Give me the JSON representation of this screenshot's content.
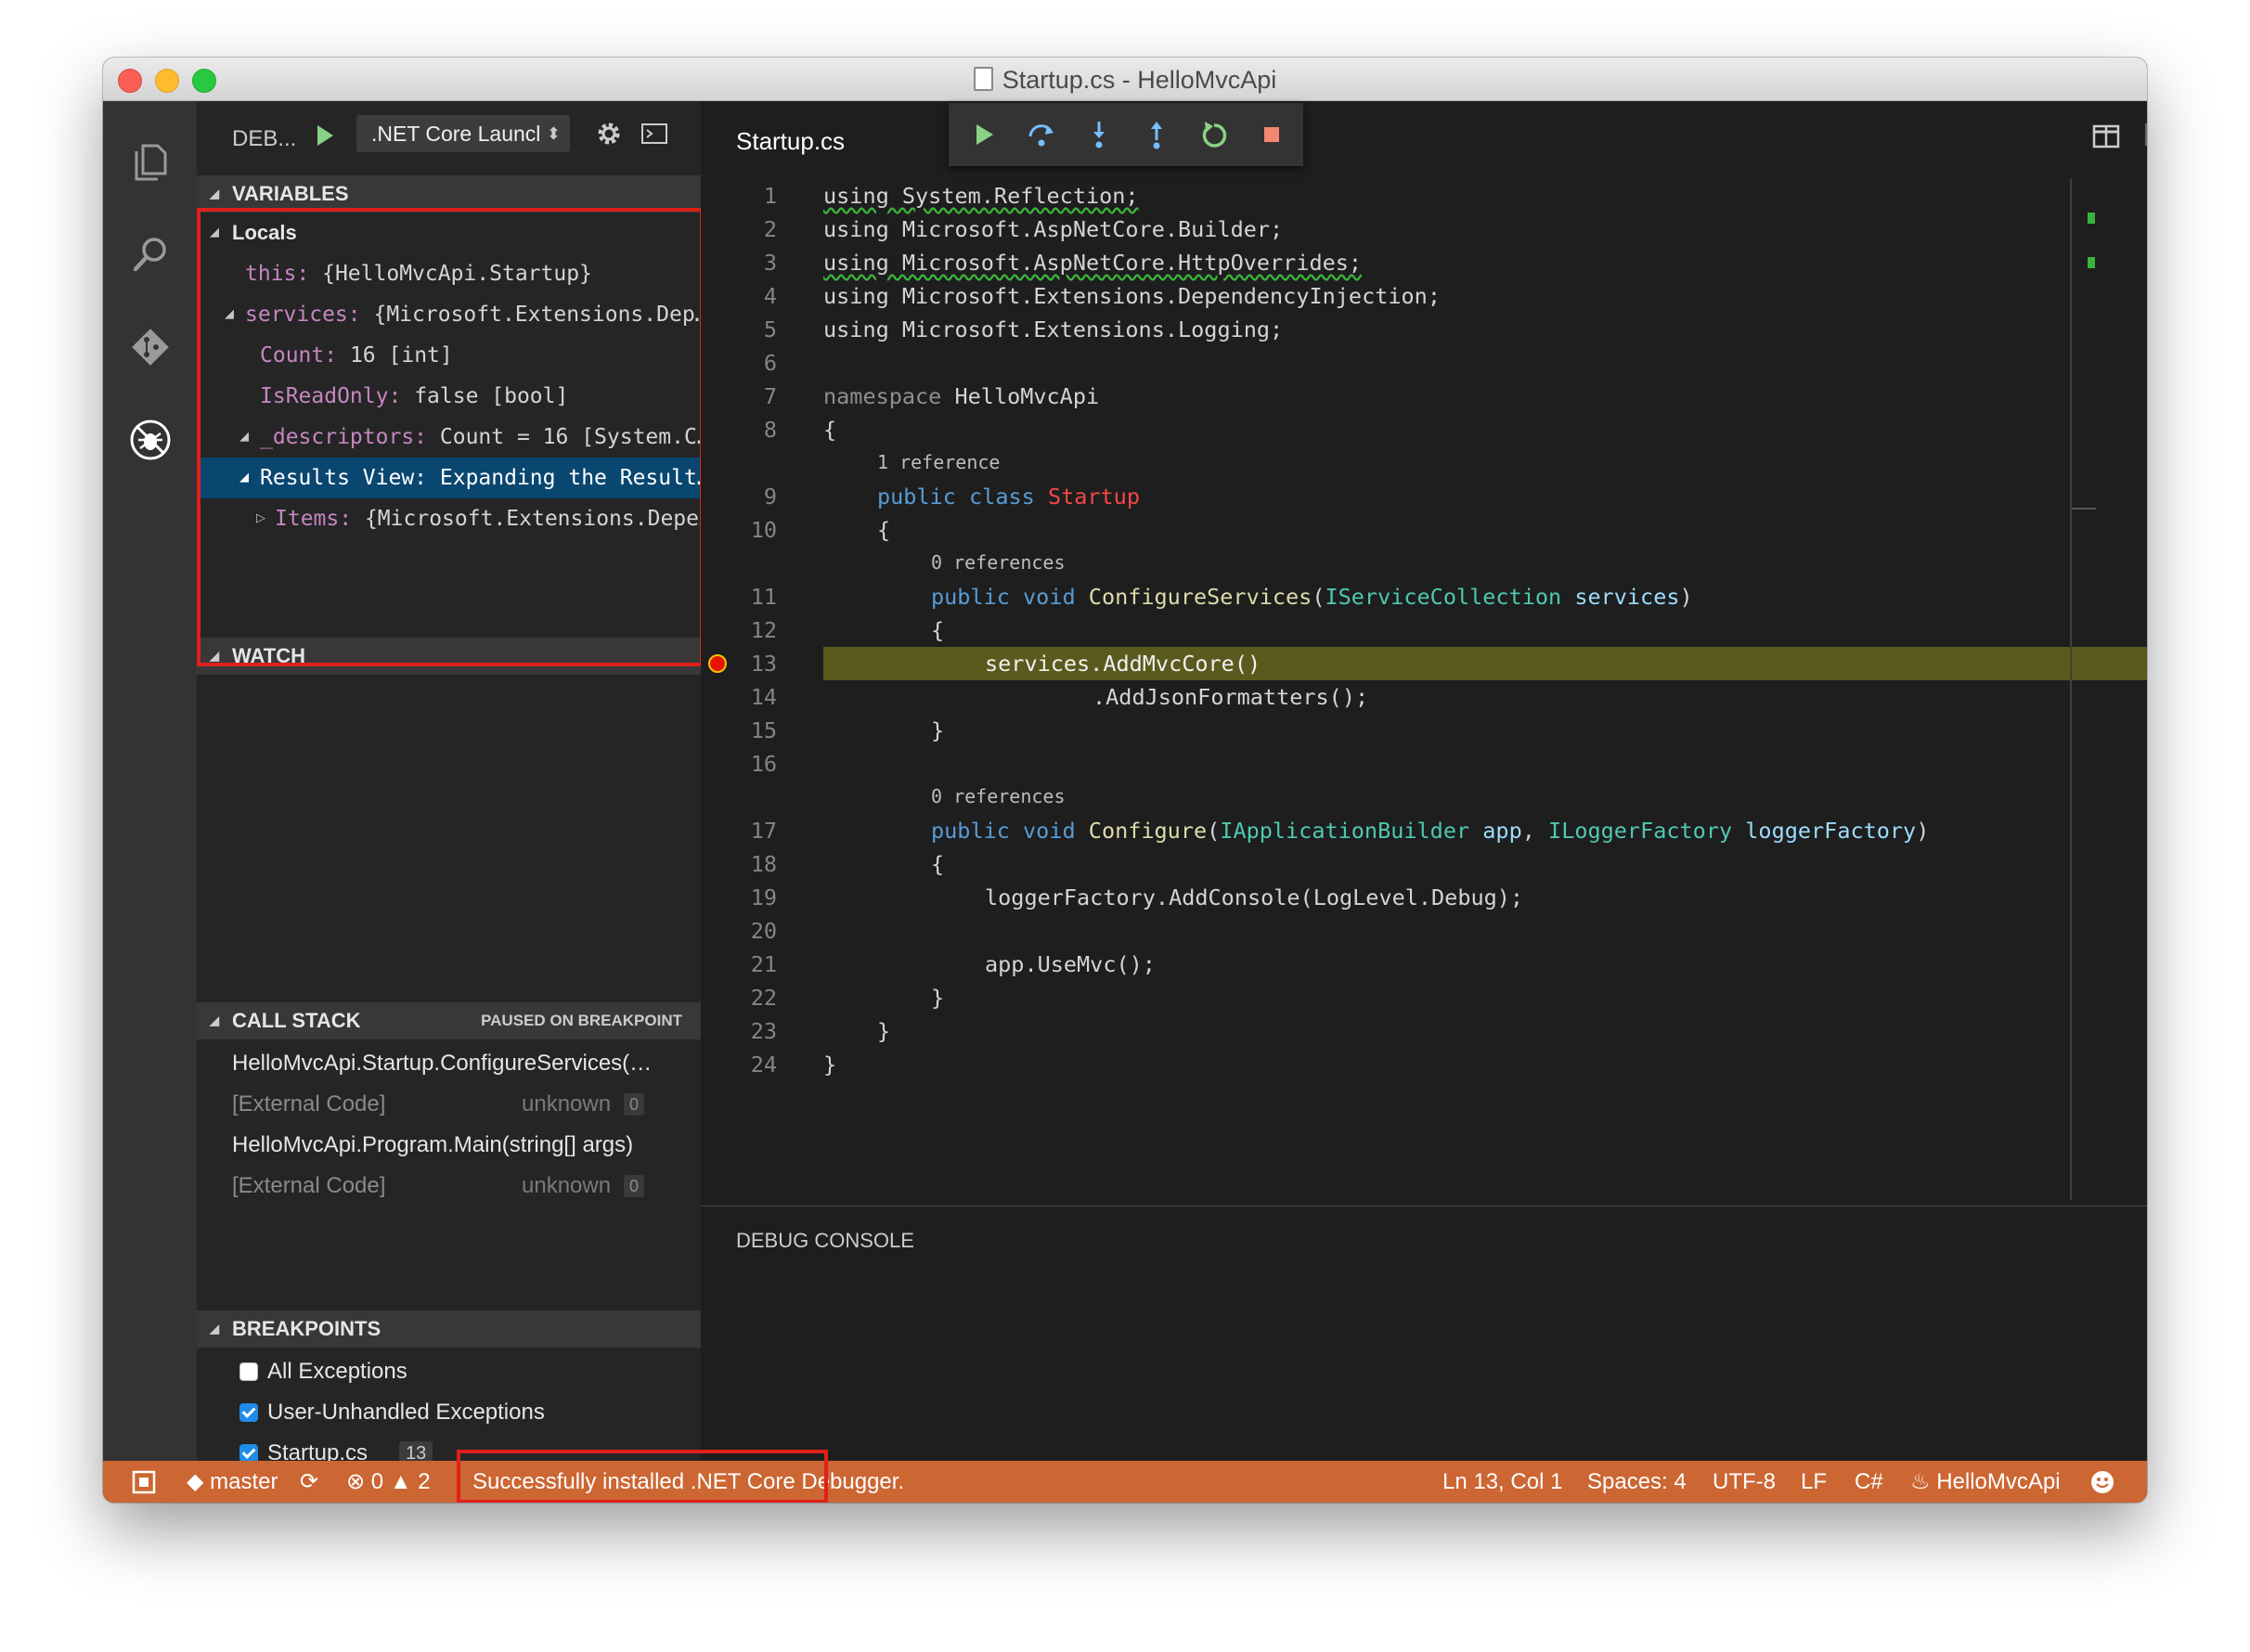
{
  "window": {
    "title": "Startup.cs - HelloMvcApi"
  },
  "debug_header": {
    "label": "DEB...",
    "configuration": ".NET Core Launcl"
  },
  "variables": {
    "title": "VARIABLES",
    "scope": "Locals",
    "items": [
      {
        "key": "this:",
        "value": "{HelloMvcApi.Startup}"
      },
      {
        "key": "services:",
        "value": "{Microsoft.Extensions.Dep…"
      },
      {
        "key": "Count:",
        "value": "16 [int]"
      },
      {
        "key": "IsReadOnly:",
        "value": "false [bool]"
      },
      {
        "key": "_descriptors:",
        "value": "Count = 16 [System.C…"
      },
      {
        "key": "Results View:",
        "value": "Expanding the Result…"
      },
      {
        "key": "Items:",
        "value": "{Microsoft.Extensions.Depe…"
      }
    ]
  },
  "watch": {
    "title": "WATCH"
  },
  "call_stack": {
    "title": "CALL STACK",
    "status": "PAUSED ON BREAKPOINT",
    "frames": [
      {
        "name": "HelloMvcApi.Startup.ConfigureServices(…",
        "source": "",
        "line": ""
      },
      {
        "name": "[External Code]",
        "source": "unknown",
        "line": "0"
      },
      {
        "name": "HelloMvcApi.Program.Main(string[] args)",
        "source": "",
        "line": ""
      },
      {
        "name": "[External Code]",
        "source": "unknown",
        "line": "0"
      }
    ]
  },
  "breakpoints": {
    "title": "BREAKPOINTS",
    "items": [
      {
        "label": "All Exceptions",
        "checked": false,
        "line": ""
      },
      {
        "label": "User-Unhandled Exceptions",
        "checked": true,
        "line": ""
      },
      {
        "label": "Startup.cs",
        "checked": true,
        "line": "13"
      }
    ]
  },
  "editor": {
    "tab": "Startup.cs",
    "line_numbers": [
      "1",
      "2",
      "3",
      "4",
      "5",
      "6",
      "7",
      "8",
      "9",
      "10",
      "11",
      "12",
      "13",
      "14",
      "15",
      "16",
      "17",
      "18",
      "19",
      "20",
      "21",
      "22",
      "23",
      "24"
    ],
    "code": {
      "l1": "using System.Reflection;",
      "l2": "using Microsoft.AspNetCore.Builder;",
      "l3": "using Microsoft.AspNetCore.HttpOverrides;",
      "l4": "using Microsoft.Extensions.DependencyInjection;",
      "l5": "using Microsoft.Extensions.Logging;",
      "l7_kw": "namespace",
      "l7_name": "HelloMvcApi",
      "l8": "{",
      "l9_kw": "public class",
      "l9_cls": "Startup",
      "l10": "{",
      "l11_kw": "public void",
      "l11_fn": "ConfigureServices",
      "l11_open": "(",
      "l11_type": "IServiceCollection",
      "l11_param": "services",
      "l11_close": ")",
      "l12": "{",
      "l13": "services.AddMvcCore()",
      "l14": ".AddJsonFormatters();",
      "l15": "}",
      "l17_kw": "public void",
      "l17_fn": "Configure",
      "l17_open": "(",
      "l17_type1": "IApplicationBuilder",
      "l17_param1": "app",
      "l17_comma": ",",
      "l17_type2": "ILoggerFactory",
      "l17_param2": "loggerFactory",
      "l17_close": ")",
      "l18": "{",
      "l19": "loggerFactory.AddConsole(LogLevel.Debug);",
      "l21": "app.UseMvc();",
      "l22": "}",
      "l23": "}",
      "l24": "}"
    },
    "lens_class": "1 reference",
    "lens_configure_services": "0 references",
    "lens_configure": "0 references",
    "current_line": "13"
  },
  "debug_console": {
    "title": "DEBUG CONSOLE",
    "prompt": "›"
  },
  "status_bar": {
    "branch": "master",
    "errors": "0",
    "warnings": "2",
    "message": "Successfully installed .NET Core Debugger.",
    "position": "Ln 13, Col 1",
    "spaces": "Spaces: 4",
    "encoding": "UTF-8",
    "eol": "LF",
    "language": "C#",
    "project": "HelloMvcApi"
  },
  "colors": {
    "status_bar": "#cc6633",
    "highlight_box": "#e0201a",
    "current_line": "#5a5a1e",
    "selected_row": "#094771"
  }
}
